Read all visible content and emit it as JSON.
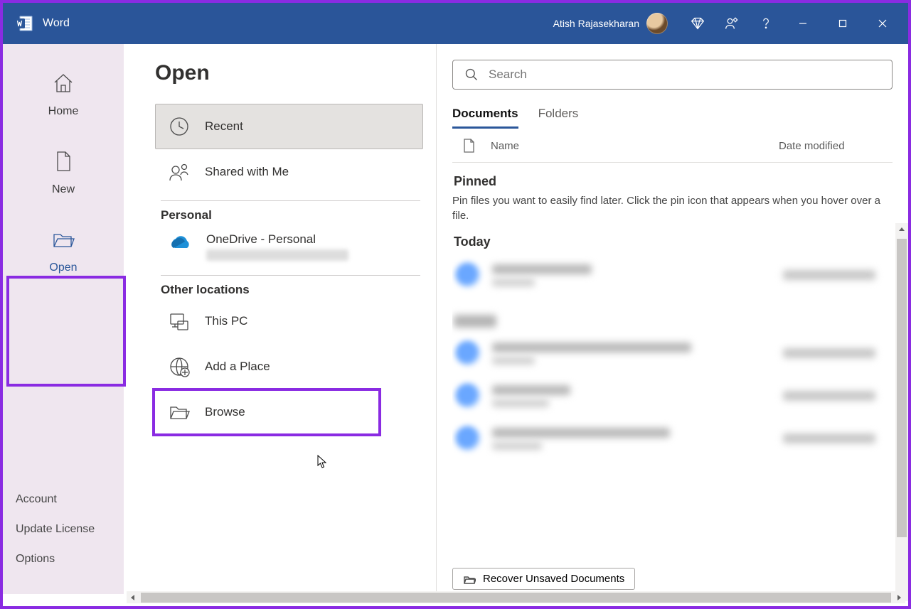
{
  "titlebar": {
    "app_name": "Word",
    "user_name": "Atish Rajasekharan"
  },
  "sidebar": {
    "home": "Home",
    "new": "New",
    "open": "Open",
    "account": "Account",
    "update": "Update License",
    "options": "Options"
  },
  "page": {
    "title": "Open",
    "recent": "Recent",
    "shared": "Shared with Me",
    "personal_head": "Personal",
    "onedrive": "OneDrive - Personal",
    "other_head": "Other locations",
    "thispc": "This PC",
    "addplace": "Add a Place",
    "browse": "Browse"
  },
  "files": {
    "search_placeholder": "Search",
    "tab_docs": "Documents",
    "tab_folders": "Folders",
    "col_name": "Name",
    "col_date": "Date modified",
    "pinned_head": "Pinned",
    "pinned_desc": "Pin files you want to easily find later. Click the pin icon that appears when you hover over a file.",
    "today_head": "Today",
    "recover": "Recover Unsaved Documents"
  }
}
